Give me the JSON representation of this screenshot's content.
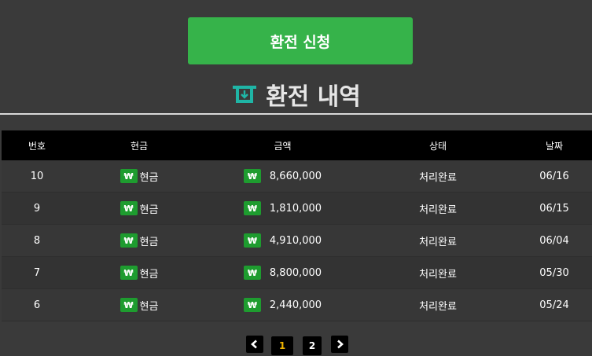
{
  "apply_button": {
    "label": "환전 신청"
  },
  "section": {
    "title": "환전 내역"
  },
  "table": {
    "headers": {
      "no": "번호",
      "type": "현금",
      "amount": "금액",
      "status": "상태",
      "date": "날짜"
    },
    "currency_symbol": "₩",
    "rows": [
      {
        "no": "10",
        "type": "현금",
        "amount": "8,660,000",
        "status": "처리완료",
        "date": "06/16"
      },
      {
        "no": "9",
        "type": "현금",
        "amount": "1,810,000",
        "status": "처리완료",
        "date": "06/15"
      },
      {
        "no": "8",
        "type": "현금",
        "amount": "4,910,000",
        "status": "처리완료",
        "date": "06/04"
      },
      {
        "no": "7",
        "type": "현금",
        "amount": "8,800,000",
        "status": "처리완료",
        "date": "05/30"
      },
      {
        "no": "6",
        "type": "현금",
        "amount": "2,440,000",
        "status": "처리완료",
        "date": "05/24"
      }
    ]
  },
  "pagination": {
    "pages": [
      "1",
      "2"
    ],
    "current": "1"
  },
  "colors": {
    "accent_green": "#36b34a",
    "won_badge": "#1e9c2f",
    "active_page": "#f0b400",
    "icon_teal": "#1fb5a6"
  }
}
